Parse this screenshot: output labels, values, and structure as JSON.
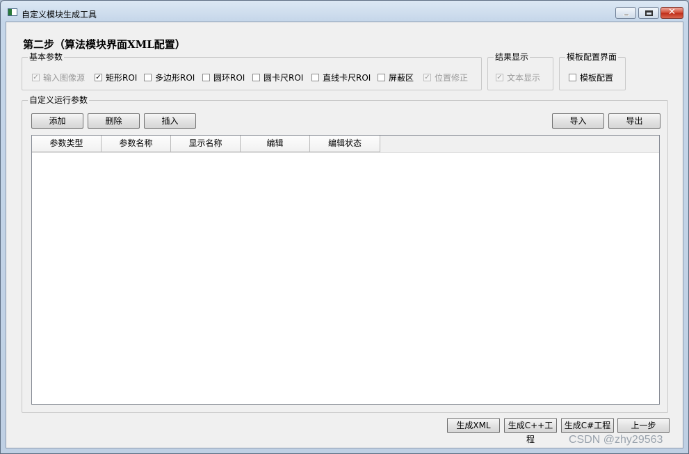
{
  "window": {
    "title": "自定义模块生成工具",
    "close_glyph": "✕"
  },
  "heading": "第二步（算法模块界面XML配置）",
  "basic_params": {
    "legend": "基本参数",
    "items": [
      {
        "label": "输入图像源",
        "checked": true,
        "enabled": false
      },
      {
        "label": "矩形ROI",
        "checked": true,
        "enabled": true
      },
      {
        "label": "多边形ROI",
        "checked": false,
        "enabled": true
      },
      {
        "label": "圆环ROI",
        "checked": false,
        "enabled": true
      },
      {
        "label": "圆卡尺ROI",
        "checked": false,
        "enabled": true
      },
      {
        "label": "直线卡尺ROI",
        "checked": false,
        "enabled": true
      },
      {
        "label": "屏蔽区",
        "checked": false,
        "enabled": true
      },
      {
        "label": "位置修正",
        "checked": true,
        "enabled": false
      }
    ]
  },
  "result_display": {
    "legend": "结果显示",
    "items": [
      {
        "label": "文本显示",
        "checked": true,
        "enabled": false
      }
    ]
  },
  "template_ui": {
    "legend": "模板配置界面",
    "items": [
      {
        "label": "模板配置",
        "checked": false,
        "enabled": true
      }
    ]
  },
  "run_params": {
    "legend": "自定义运行参数",
    "buttons": {
      "add": "添加",
      "delete": "删除",
      "insert": "插入",
      "import": "导入",
      "export": "导出"
    },
    "columns": [
      "参数类型",
      "参数名称",
      "显示名称",
      "编辑",
      "编辑状态"
    ],
    "rows": []
  },
  "footer": {
    "gen_xml": "生成XML",
    "gen_cpp": "生成C++工程",
    "gen_cs": "生成C#工程",
    "prev": "上一步"
  },
  "watermark": "CSDN @zhy29563",
  "check_glyph": "✓"
}
